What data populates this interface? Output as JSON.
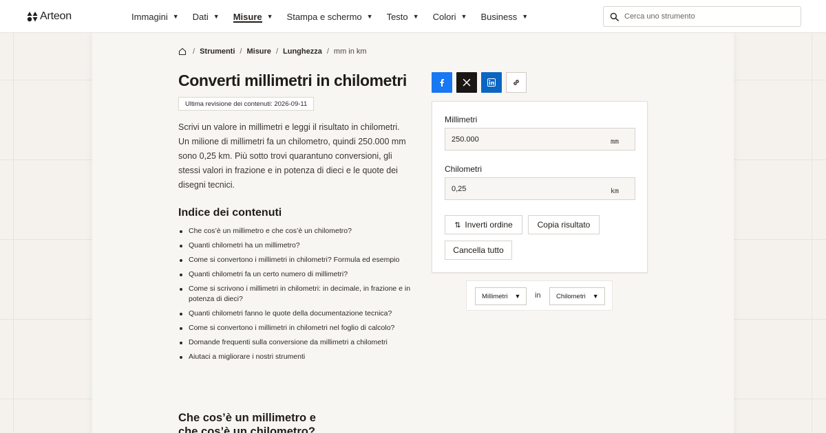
{
  "brand": {
    "name": "Arteon"
  },
  "nav": {
    "items": [
      {
        "label": "Immagini",
        "active": false
      },
      {
        "label": "Dati",
        "active": false
      },
      {
        "label": "Misure",
        "active": true
      },
      {
        "label": "Stampa e schermo",
        "active": false
      },
      {
        "label": "Testo",
        "active": false
      },
      {
        "label": "Colori",
        "active": false
      },
      {
        "label": "Business",
        "active": false
      }
    ],
    "caret": "▼"
  },
  "search": {
    "placeholder": "Cerca uno strumento",
    "icon": "search-icon"
  },
  "breadcrumb": {
    "home_icon": "home-icon",
    "separator": "/",
    "items": [
      "Strumenti",
      "Misure",
      "Lunghezza"
    ],
    "current": "mm in km"
  },
  "page": {
    "title": "Converti millimetri in chilometri",
    "revision": "Ultima revisione dei contenuti: 2026-09-11",
    "intro": "Scrivi un valore in millimetri e leggi il risultato in chilometri. Un milione di millimetri fa un chilometro, quindi 250.000 mm sono 0,25 km. Più sotto trovi quarantuno conversioni, gli stessi valori in frazione e in potenza di dieci e le quote dei disegni tecnici."
  },
  "toc": {
    "title": "Indice dei contenuti",
    "items": [
      "Che cos’è un millimetro e che cos’è un chilometro?",
      "Quanti chilometri ha un millimetro?",
      "Come si convertono i millimetri in chilometri? Formula ed esempio",
      "Quanti chilometri fa un certo numero di millimetri?",
      "Come si scrivono i millimetri in chilometri: in decimale, in frazione e in potenza di dieci?",
      "Quanti chilometri fanno le quote della documentazione tecnica?",
      "Come si convertono i millimetri in chilometri nel foglio di calcolo?",
      "Domande frequenti sulla conversione da millimetri a chilometri",
      "Aiutaci a migliorare i nostri strumenti"
    ]
  },
  "section": {
    "heading": "Che cos’è un millimetro e che cos’è un chilometro?"
  },
  "share": {
    "buttons": [
      {
        "name": "facebook",
        "color": "#1877f2",
        "icon": "facebook-icon"
      },
      {
        "name": "x",
        "color": "#1a1613",
        "icon": "x-icon"
      },
      {
        "name": "linkedin",
        "color": "#0a66c2",
        "icon": "linkedin-icon"
      },
      {
        "name": "link",
        "color": "#ffffff",
        "icon": "link-icon"
      }
    ]
  },
  "converter": {
    "from": {
      "label": "Millimetri",
      "value": "250.000",
      "unit": "mm"
    },
    "to": {
      "label": "Chilometri",
      "value": "0,25",
      "unit": "km"
    },
    "swap_label": "Inverti ordine",
    "swap_icon": "⇅",
    "copy_label": "Copia risultato",
    "clear_label": "Cancella tutto"
  },
  "unit_select": {
    "from": "Millimetri",
    "connector": "in",
    "to": "Chilometri",
    "caret": "▼"
  }
}
